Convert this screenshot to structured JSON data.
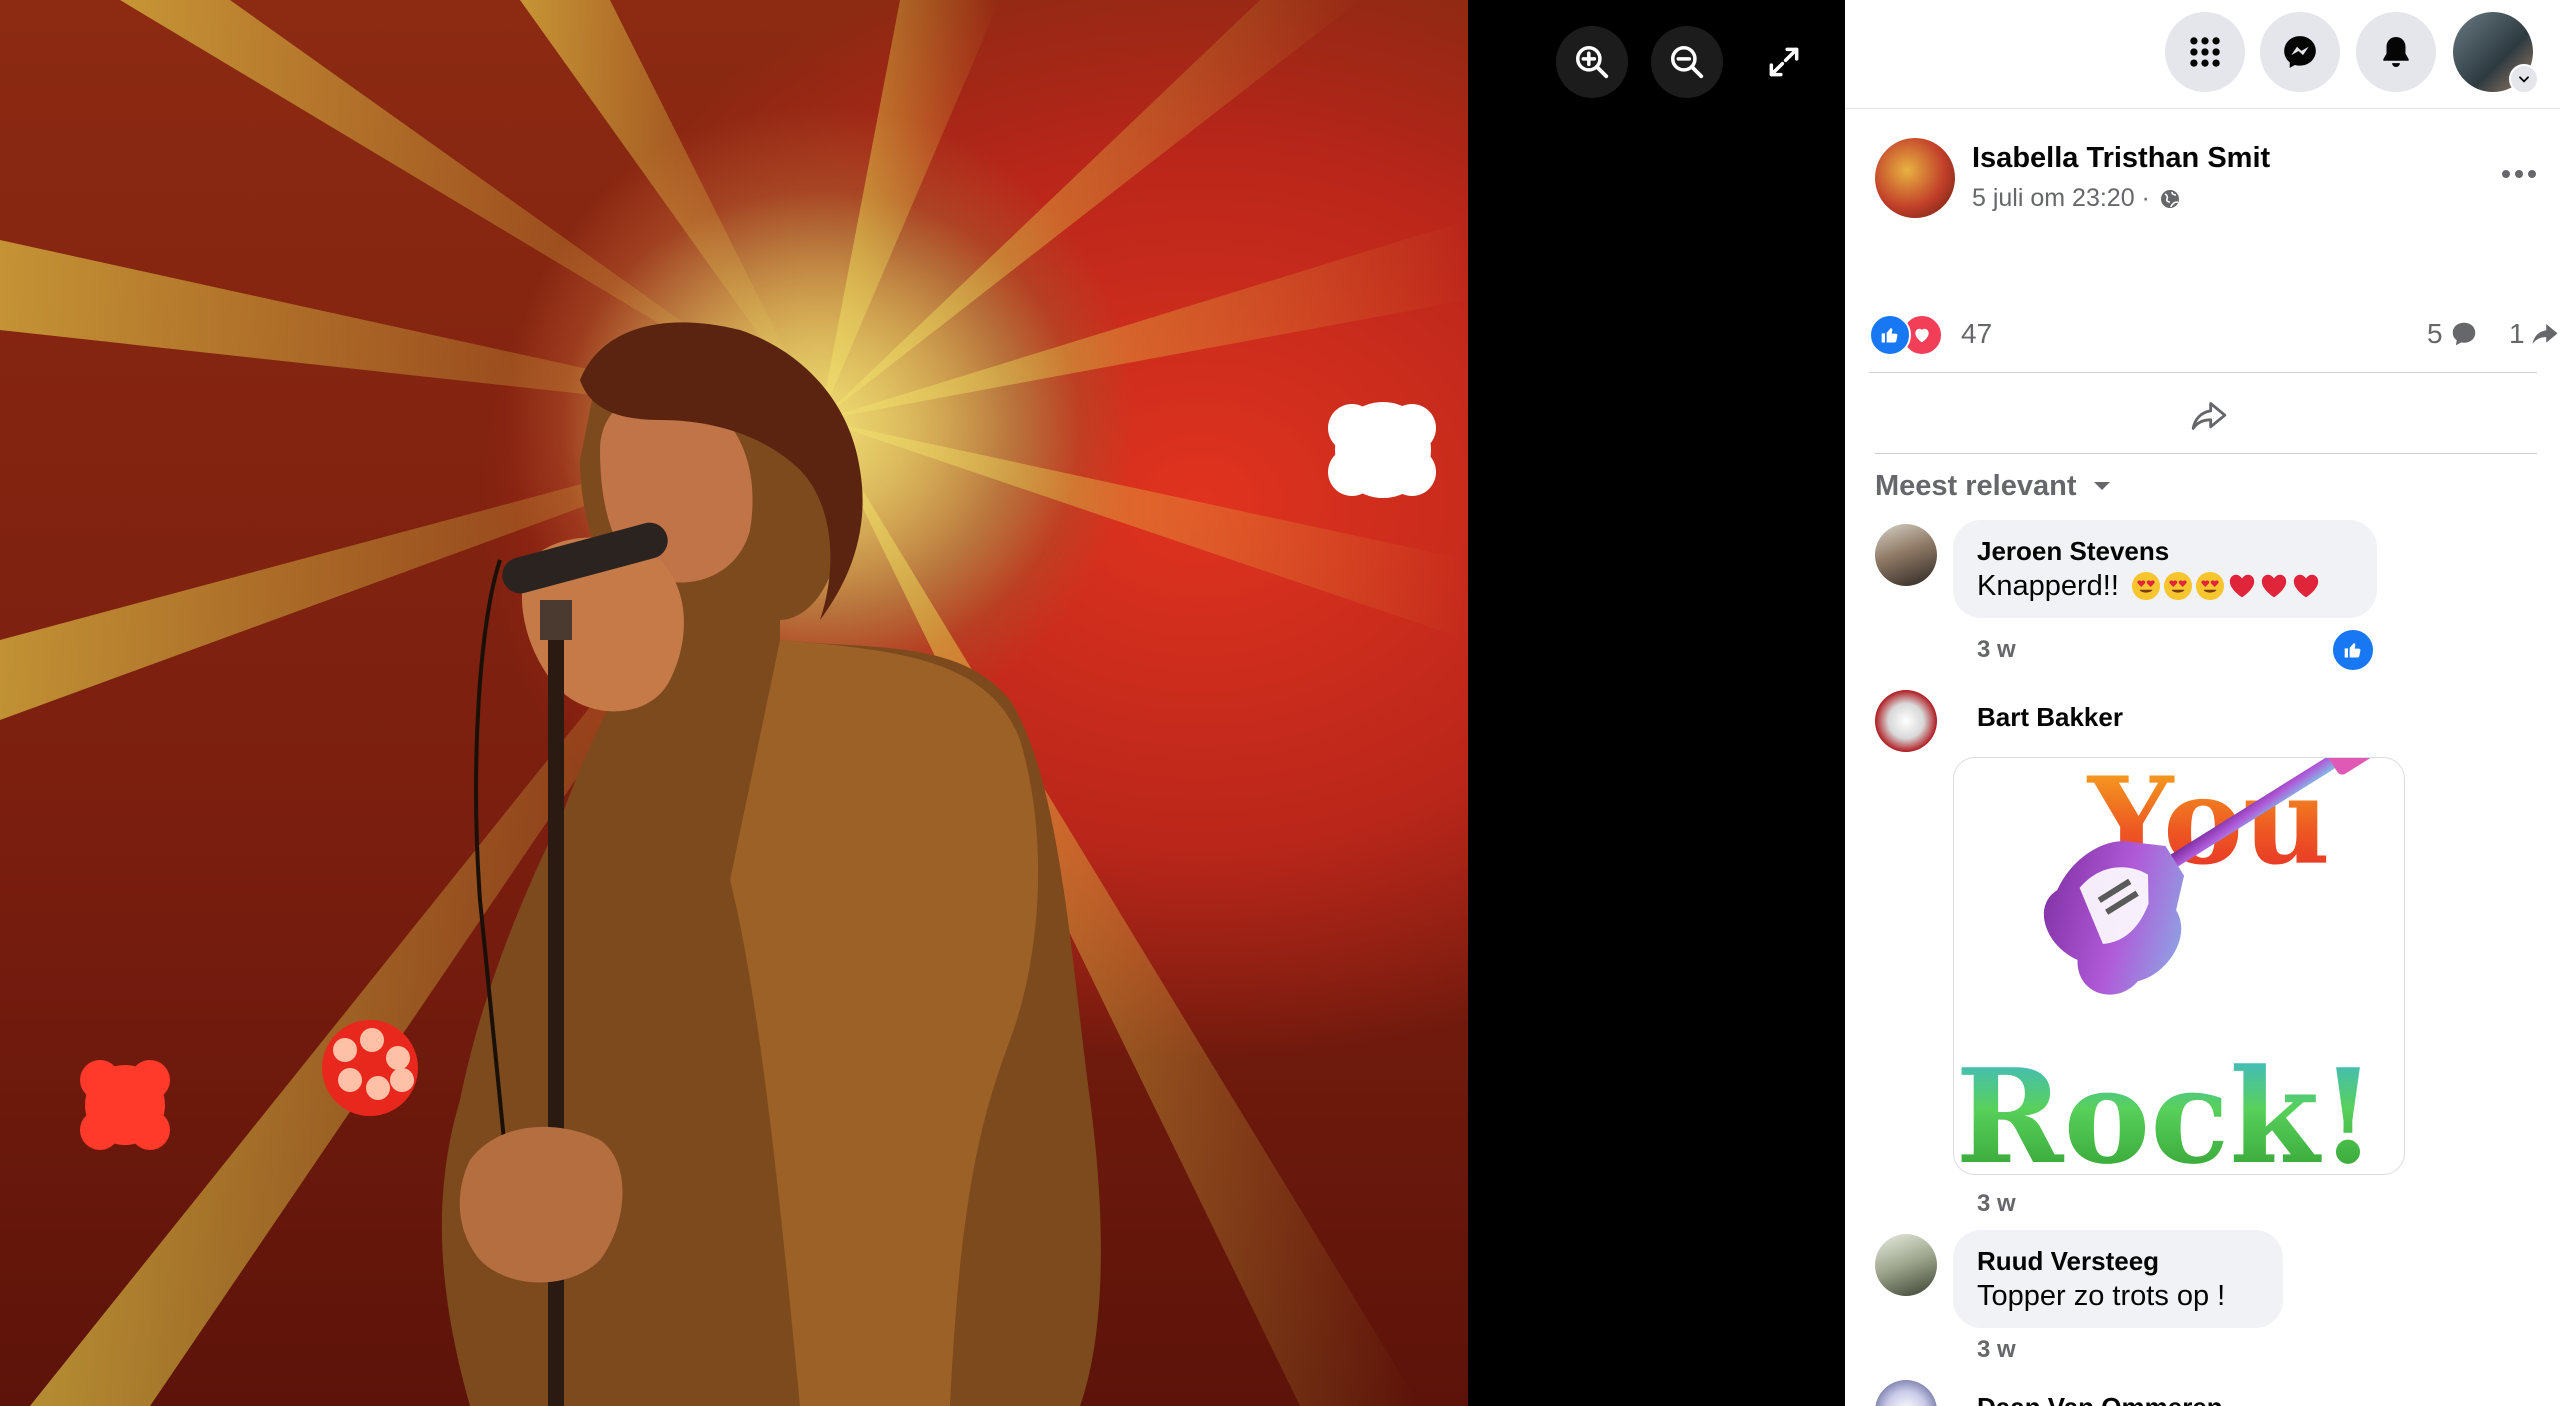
{
  "viewer": {
    "zoom_in_icon": "zoom-in-icon",
    "zoom_out_icon": "zoom-out-icon",
    "fullscreen_icon": "expand-icon"
  },
  "topbar": {
    "menu_icon": "grid-menu-icon",
    "messenger_icon": "messenger-icon",
    "notifications_icon": "bell-icon",
    "account_icon": "chevron-down-icon"
  },
  "post": {
    "author": "Isabella Tristhan Smit",
    "time": "5 juli om 23:20 ·",
    "privacy_icon": "globe-icon",
    "more_icon": "ellipsis-icon",
    "reaction_count": "47",
    "comment_count": "5",
    "share_count": "1"
  },
  "comments_section": {
    "sort_label": "Meest relevant",
    "comments": [
      {
        "name": "Jeroen Stevens",
        "text": "Knapperd!!",
        "emoji_count": 6,
        "time": "3 w",
        "reaction": "like"
      },
      {
        "name": "Bart Bakker",
        "gif_text_top": "You",
        "gif_text_bottom": "Rock!",
        "time": "3 w"
      },
      {
        "name": "Ruud Versteeg",
        "text": "Topper zo trots op !",
        "time": "3 w"
      },
      {
        "name": "Daan Van Ommeren"
      }
    ]
  },
  "colors": {
    "fb_blue": "#1877f2",
    "love_red": "#f33e58",
    "bubble_bg": "#f0f2f5",
    "secondary_text": "#65676b"
  }
}
